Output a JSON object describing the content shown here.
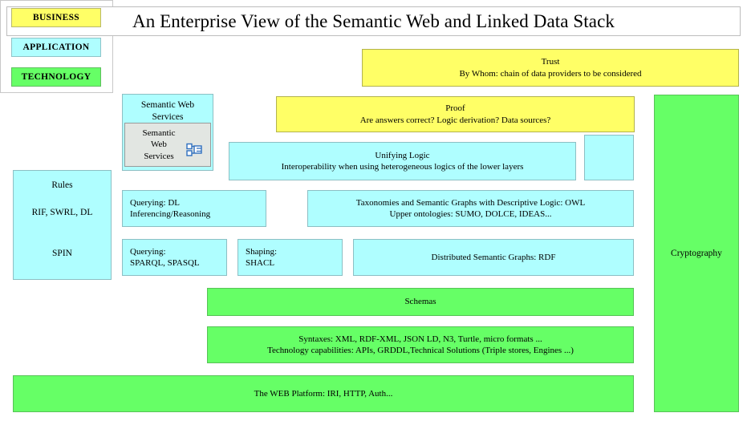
{
  "title": "An Enterprise View of the Semantic Web and Linked Data Stack",
  "colors": {
    "business": "#FFFF66",
    "application": "#AFFEFF",
    "technology": "#66FF66",
    "component_box": "#E2E6E2",
    "page_background": "#FFFFFF",
    "text": "#000000"
  },
  "legend": {
    "items": [
      {
        "label": "BUSINESS",
        "color": "#FFFF66"
      },
      {
        "label": "APPLICATION",
        "color": "#AFFEFF"
      },
      {
        "label": "TECHNOLOGY",
        "color": "#66FF66"
      }
    ]
  },
  "blocks": {
    "semantic_web_services": {
      "container_label": "Semantic Web\nServices",
      "component_label": "Semantic\nWeb\nServices",
      "icon": "application-component-icon",
      "layer": "application"
    },
    "trust": {
      "title": "Trust",
      "subtitle": "By Whom: chain of data providers to be considered",
      "layer": "business"
    },
    "proof": {
      "title": "Proof",
      "subtitle": "Are answers correct? Logic derivation? Data sources?",
      "layer": "business"
    },
    "unifying_logic": {
      "title": "Unifying Logic",
      "subtitle": "Interoperability when using heterogeneous logics of the lower layers",
      "layer": "application"
    },
    "unifying_logic_side": {
      "label": "",
      "layer": "application"
    },
    "rules": {
      "title": "Rules",
      "line_1": "RIF, SWRL, DL",
      "line_2": "SPIN",
      "layer": "application"
    },
    "querying_dl": {
      "line_1": "Querying: DL",
      "line_2": "Inferencing/Reasoning",
      "layer": "application"
    },
    "taxonomies": {
      "line_1": "Taxonomies and Semantic Graphs with Descriptive Logic: OWL",
      "line_2": "Upper ontologies: SUMO, DOLCE, IDEAS...",
      "layer": "application"
    },
    "querying_sparql": {
      "line_1": "Querying:",
      "line_2": "SPARQL, SPASQL",
      "layer": "application"
    },
    "shaping_shacl": {
      "line_1": "Shaping:",
      "line_2": "SHACL",
      "layer": "application"
    },
    "rdf": {
      "label": "Distributed Semantic Graphs: RDF",
      "layer": "application"
    },
    "schemas": {
      "label": "Schemas",
      "layer": "technology"
    },
    "syntaxes": {
      "line_1": "Syntaxes: XML, RDF-XML, JSON LD, N3, Turtle, micro formats ...",
      "line_2": "Technology capabilities: APIs, GRDDL,Technical Solutions (Triple stores, Engines ...)",
      "layer": "technology"
    },
    "web_platform": {
      "label": "The WEB Platform: IRI, HTTP, Auth...",
      "layer": "technology"
    },
    "cryptography": {
      "label": "Cryptography",
      "layer": "technology"
    }
  }
}
